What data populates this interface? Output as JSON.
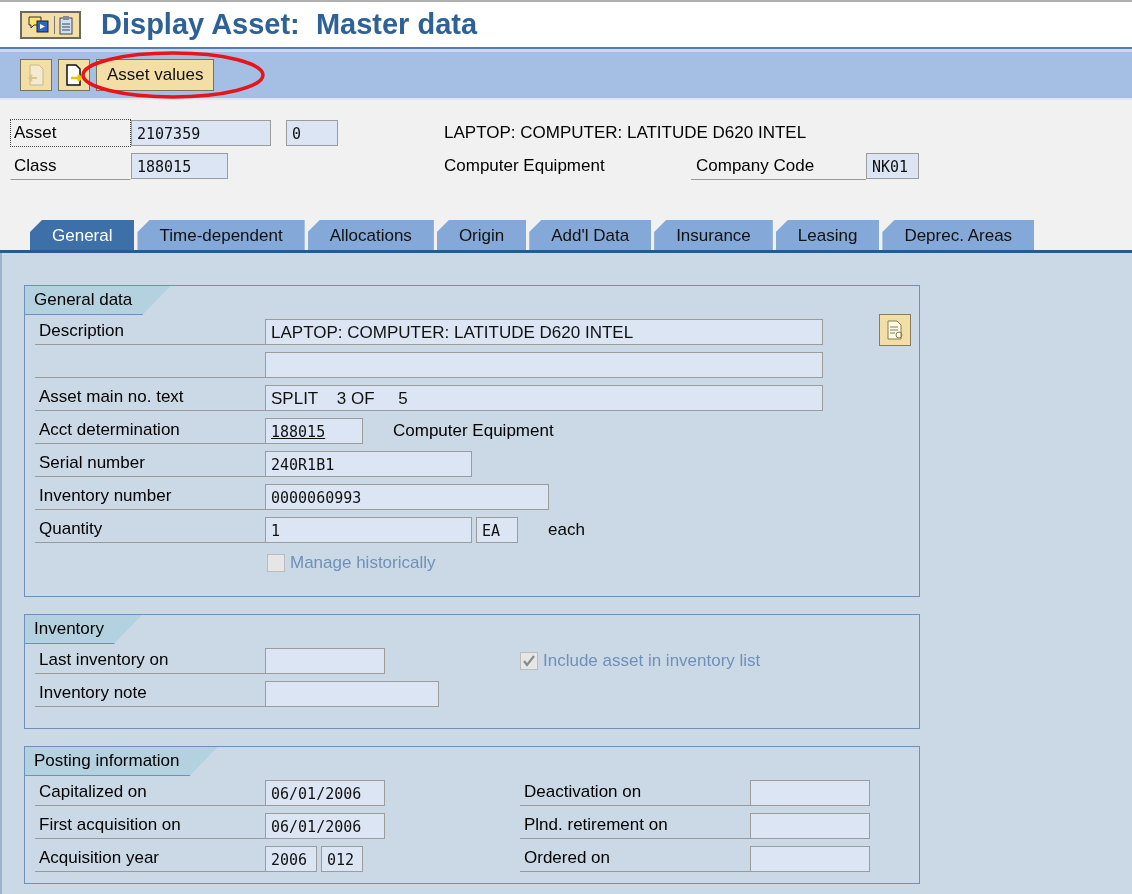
{
  "title": "Display Asset:  Master data",
  "toolbar": {
    "button": "Asset values"
  },
  "header": {
    "asset_label": "Asset",
    "asset_label_focused": true,
    "asset": "2107359",
    "sub_number": "0",
    "description": "LAPTOP: COMPUTER: LATITUDE D620 INTEL",
    "class_label": "Class",
    "class": "188015",
    "class_name": "Computer Equipment",
    "company_code_label": "Company Code",
    "company_code": "NK01"
  },
  "tabs": [
    {
      "label": "General",
      "selected": true
    },
    {
      "label": "Time-dependent",
      "selected": false
    },
    {
      "label": "Allocations",
      "selected": false
    },
    {
      "label": "Origin",
      "selected": false
    },
    {
      "label": "Add'l Data",
      "selected": false
    },
    {
      "label": "Insurance",
      "selected": false
    },
    {
      "label": "Leasing",
      "selected": false
    },
    {
      "label": "Deprec. Areas",
      "selected": false
    }
  ],
  "sections": [
    {
      "title": "General data",
      "long_text_button": true,
      "rows": [
        {
          "kind": "field",
          "label": "Description",
          "fields": [
            {
              "kind": "long",
              "value": "LAPTOP: COMPUTER: LATITUDE D620 INTEL"
            }
          ]
        },
        {
          "kind": "field",
          "fields": [
            {
              "kind": "long"
            }
          ]
        },
        {
          "kind": "field",
          "label": "Asset main no. text",
          "fields": [
            {
              "kind": "long",
              "value": "SPLIT    3 OF     5"
            }
          ]
        },
        {
          "kind": "field",
          "label": "Acct determination",
          "fields": [
            {
              "kind": "key",
              "value": "188015"
            }
          ],
          "note": "Computer Equipment"
        },
        {
          "kind": "field",
          "label": "Serial number",
          "fields": [
            {
              "kind": "medium",
              "value": "240R1B1"
            }
          ]
        },
        {
          "kind": "field",
          "label": "Inventory number",
          "fields": [
            {
              "kind": "wide",
              "value": "0000060993"
            }
          ]
        },
        {
          "kind": "field",
          "label": "Quantity",
          "fields": [
            {
              "kind": "medium",
              "value": "1"
            },
            {
              "kind": "unit",
              "value": "EA"
            }
          ],
          "note": "each"
        },
        {
          "kind": "checkbox",
          "label": "Manage historically",
          "checked": false,
          "disabled": true
        }
      ]
    },
    {
      "title": "Inventory",
      "long_text_button": false,
      "rows": [
        {
          "kind": "field",
          "label": "Last inventory on",
          "fields": [
            {
              "kind": "date"
            }
          ]
        },
        {
          "kind": "field",
          "label": "Inventory note",
          "fields": [
            {
              "kind": "note"
            }
          ]
        }
      ],
      "side": [
        {
          "kind": "checkbox",
          "label": "Include asset in inventory list",
          "checked": true,
          "disabled": true
        }
      ]
    },
    {
      "title": "Posting information",
      "long_text_button": false,
      "rows": [
        {
          "kind": "field",
          "label": "Capitalized on",
          "fields": [
            {
              "kind": "date",
              "value": "06/01/2006"
            }
          ]
        },
        {
          "kind": "field",
          "label": "First acquisition on",
          "fields": [
            {
              "kind": "date",
              "value": "06/01/2006"
            }
          ]
        },
        {
          "kind": "field",
          "label": "Acquisition year",
          "fields": [
            {
              "kind": "year",
              "value": "2006"
            },
            {
              "kind": "period",
              "value": "012"
            }
          ]
        }
      ],
      "side": [
        {
          "kind": "field",
          "label": "Deactivation on",
          "fields": [
            {
              "kind": "date"
            }
          ]
        },
        {
          "kind": "field",
          "label": "Plnd. retirement on",
          "fields": [
            {
              "kind": "date"
            }
          ]
        },
        {
          "kind": "field",
          "label": "Ordered on",
          "fields": [
            {
              "kind": "date"
            }
          ]
        }
      ]
    }
  ]
}
